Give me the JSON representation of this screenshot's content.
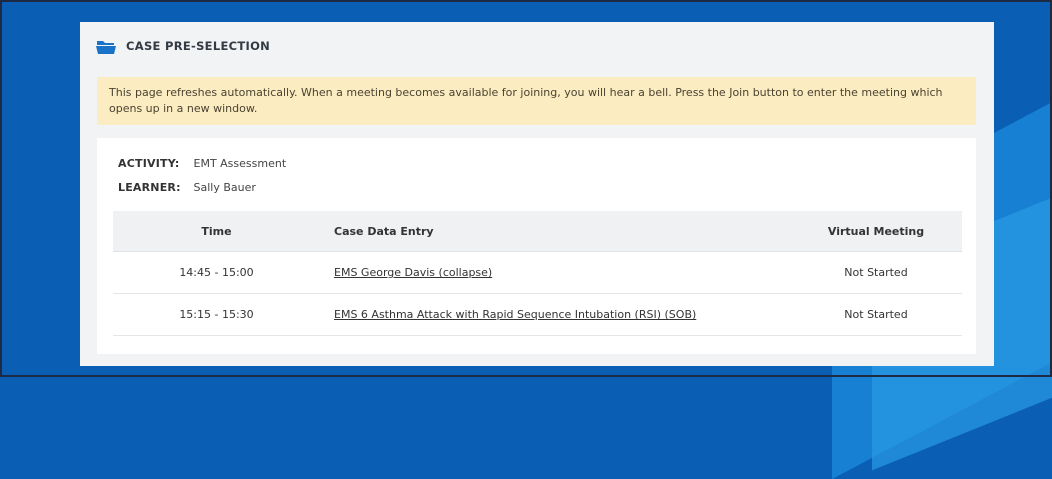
{
  "colors": {
    "background": "#0a5fb4",
    "panel": "#f2f3f4",
    "notice": "#fbecc2",
    "icon": "#1a73c7"
  },
  "header": {
    "title": "CASE PRE-SELECTION",
    "icon": "folder-open-icon"
  },
  "notice": {
    "text": "This page refreshes automatically. When a meeting becomes available for joining, you will hear a bell. Press the Join button to enter the meeting which opens up in a new window."
  },
  "details": {
    "activity_label": "ACTIVITY:",
    "activity_value": "EMT Assessment",
    "learner_label": "LEARNER:",
    "learner_value": "Sally Bauer"
  },
  "table": {
    "columns": [
      "Time",
      "Case Data Entry",
      "Virtual Meeting"
    ],
    "rows": [
      {
        "time": "14:45 - 15:00",
        "case": "EMS George Davis (collapse)",
        "meeting": "Not Started"
      },
      {
        "time": "15:15 - 15:30",
        "case": "EMS 6 Asthma Attack with Rapid Sequence Intubation (RSI) (SOB)",
        "meeting": "Not Started"
      }
    ]
  }
}
